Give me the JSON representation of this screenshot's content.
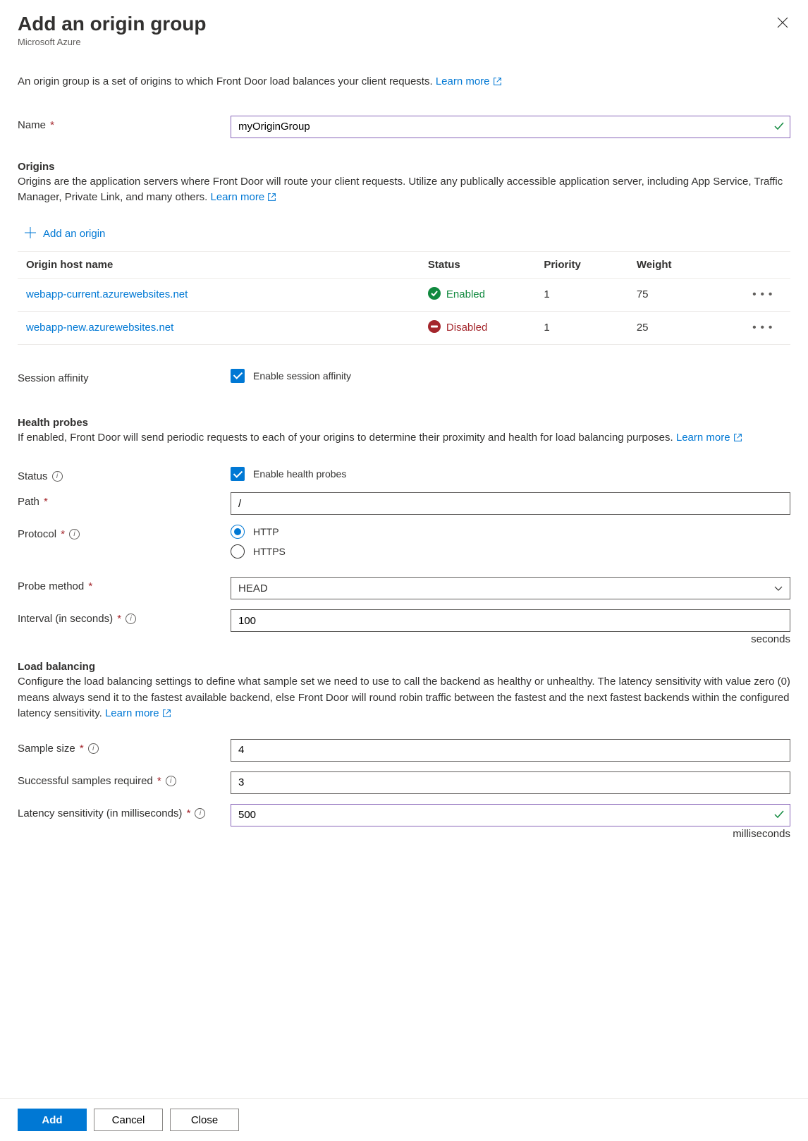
{
  "header": {
    "title": "Add an origin group",
    "subtitle": "Microsoft Azure",
    "description": "An origin group is a set of origins to which Front Door load balances your client requests.",
    "learn_more": "Learn more"
  },
  "name_field": {
    "label": "Name",
    "value": "myOriginGroup"
  },
  "origins_section": {
    "title": "Origins",
    "desc": "Origins are the application servers where Front Door will route your client requests. Utilize any publically accessible application server, including App Service, Traffic Manager, Private Link, and many others.",
    "learn_more": "Learn more",
    "add_origin": "Add an origin",
    "columns": {
      "host": "Origin host name",
      "status": "Status",
      "priority": "Priority",
      "weight": "Weight"
    },
    "rows": [
      {
        "host": "webapp-current.azurewebsites.net",
        "status": "Enabled",
        "priority": "1",
        "weight": "75"
      },
      {
        "host": "webapp-new.azurewebsites.net",
        "status": "Disabled",
        "priority": "1",
        "weight": "25"
      }
    ]
  },
  "session_affinity": {
    "label": "Session affinity",
    "checkbox_label": "Enable session affinity"
  },
  "health_probes": {
    "title": "Health probes",
    "desc": "If enabled, Front Door will send periodic requests to each of your origins to determine their proximity and health for load balancing purposes.",
    "learn_more": "Learn more",
    "status_label": "Status",
    "status_checkbox": "Enable health probes",
    "path_label": "Path",
    "path_value": "/",
    "protocol_label": "Protocol",
    "protocol_options": [
      "HTTP",
      "HTTPS"
    ],
    "protocol_selected": "HTTP",
    "method_label": "Probe method",
    "method_value": "HEAD",
    "interval_label": "Interval (in seconds)",
    "interval_value": "100",
    "interval_unit": "seconds"
  },
  "load_balancing": {
    "title": "Load balancing",
    "desc": "Configure the load balancing settings to define what sample set we need to use to call the backend as healthy or unhealthy. The latency sensitivity with value zero (0) means always send it to the fastest available backend, else Front Door will round robin traffic between the fastest and the next fastest backends within the configured latency sensitivity.",
    "learn_more": "Learn more",
    "sample_size_label": "Sample size",
    "sample_size_value": "4",
    "successful_label": "Successful samples required",
    "successful_value": "3",
    "latency_label": "Latency sensitivity (in milliseconds)",
    "latency_value": "500",
    "latency_unit": "milliseconds"
  },
  "footer": {
    "add": "Add",
    "cancel": "Cancel",
    "close": "Close"
  }
}
